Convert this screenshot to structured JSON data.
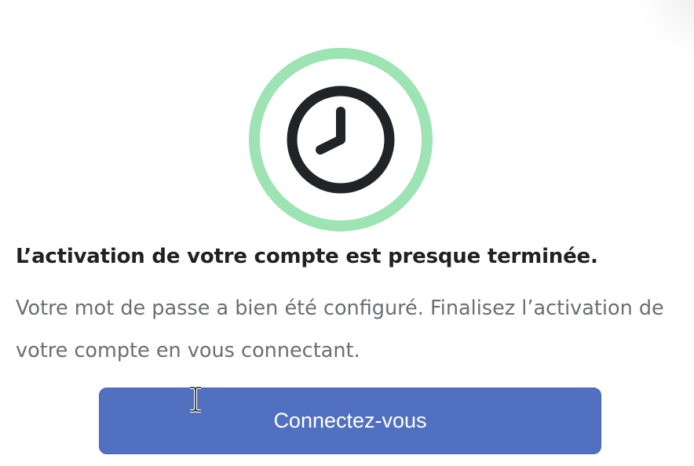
{
  "status": {
    "icon": "clock-icon",
    "ring_color": "#9de3b4",
    "icon_color": "#212427"
  },
  "title": "L’activation de votre compte est presque terminée.",
  "message": "Votre mot de passe a bien été configuré. Finalisez l’activation de votre compte en vous connectant.",
  "button": {
    "label": "Connectez-vous",
    "color": "#5170c0"
  },
  "cursor": {
    "icon": "text-cursor-icon"
  }
}
